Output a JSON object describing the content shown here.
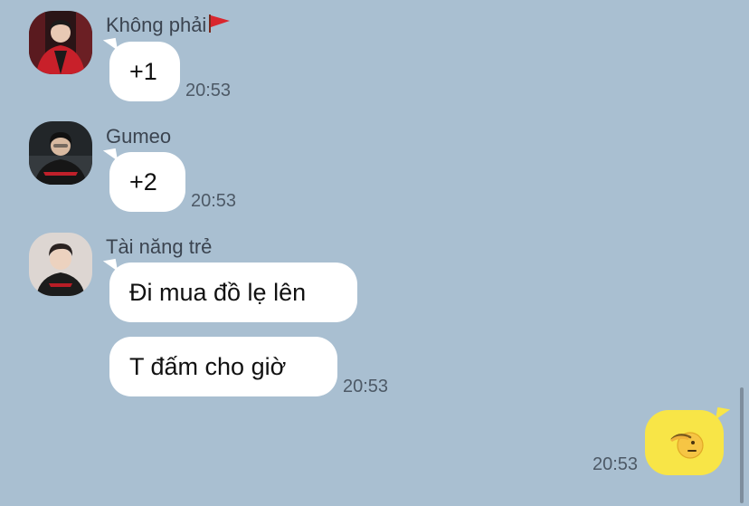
{
  "messages": [
    {
      "sender": "Không phải",
      "text": "+1",
      "time": "20:53",
      "avatar": "avatar-red-jacket"
    },
    {
      "sender": "Gumeo",
      "text": "+2",
      "time": "20:53",
      "avatar": "avatar-dark-jersey"
    },
    {
      "sender": "Tài năng trẻ",
      "texts": [
        "Đi mua đồ lẹ lên",
        "T đấm cho giờ"
      ],
      "time": "20:53",
      "avatar": "avatar-jersey-portrait"
    }
  ],
  "my_message": {
    "sticker": "saluting-face-icon",
    "time": "20:53"
  },
  "colors": {
    "background": "#a9bfd1",
    "incoming_bubble": "#ffffff",
    "outgoing_bubble": "#f8e547"
  }
}
